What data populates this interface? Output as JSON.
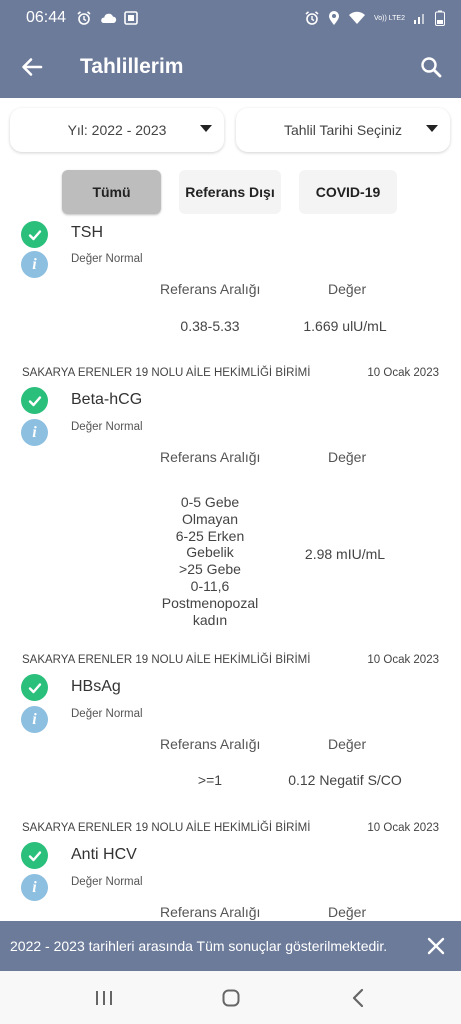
{
  "status_bar": {
    "time": "06:44",
    "lte_label": "Vo)) LTE2"
  },
  "app_bar": {
    "title": "Tahlillerim"
  },
  "filters": {
    "year_label": "Yıl: 2022 - 2023",
    "date_label": "Tahlil Tarihi Seçiniz"
  },
  "tabs": [
    {
      "label": "Tümü",
      "active": true
    },
    {
      "label": "Referans Dışı",
      "active": false
    },
    {
      "label": "COVID-19",
      "active": false
    }
  ],
  "column_headers": {
    "reference": "Referans Aralığı",
    "value": "Değer"
  },
  "results": [
    {
      "lab": "",
      "date": "",
      "test": "TSH",
      "status": "Değer Normal",
      "reference": "0.38-5.33",
      "value": "1.669 ulU/mL"
    },
    {
      "lab": "SAKARYA ERENLER 19 NOLU AİLE HEKİMLİĞİ BİRİMİ",
      "date": "10 Ocak 2023",
      "test": "Beta-hCG",
      "status": "Değer Normal",
      "reference_lines": [
        "0-5    Gebe",
        "Olmayan",
        "6-25    Erken",
        "Gebelik",
        ">25    Gebe",
        "0-11,6",
        "Postmenopozal",
        "kadın"
      ],
      "value": "2.98 mIU/mL"
    },
    {
      "lab": "SAKARYA ERENLER 19 NOLU AİLE HEKİMLİĞİ BİRİMİ",
      "date": "10 Ocak 2023",
      "test": "HBsAg",
      "status": "Değer Normal",
      "reference": ">=1",
      "value": "0.12 Negatif S/CO"
    },
    {
      "lab": "SAKARYA ERENLER 19 NOLU AİLE HEKİMLİĞİ BİRİMİ",
      "date": "10 Ocak 2023",
      "test": "Anti HCV",
      "status": "Değer Normal"
    }
  ],
  "snackbar": {
    "message": "2022 - 2023 tarihleri arasında Tüm sonuçlar gösterilmektedir."
  },
  "colors": {
    "primary": "#6d7b9a",
    "check": "#2bbf7c",
    "info": "#8cbfe0",
    "active_tab": "#bdbdbd"
  },
  "icons": [
    "alarm-icon",
    "cloud-icon",
    "photo-icon",
    "wifi-icon",
    "signal-icon",
    "battery-icon",
    "back-arrow-icon",
    "search-icon",
    "check-icon",
    "info-icon",
    "close-icon",
    "recents-icon",
    "home-icon",
    "nav-back-icon"
  ]
}
